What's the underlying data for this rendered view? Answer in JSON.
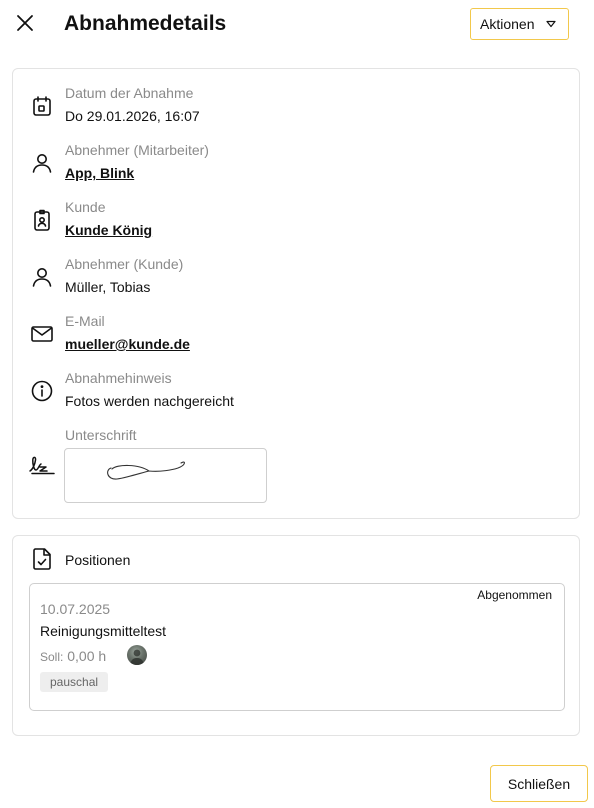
{
  "header": {
    "title": "Abnahmedetails",
    "actions_label": "Aktionen"
  },
  "details": [
    {
      "label": "Datum der Abnahme",
      "value": "Do 29.01.2026, 16:07",
      "icon": "calendar-icon",
      "link": false
    },
    {
      "label": "Abnehmer (Mitarbeiter)",
      "value": "App, Blink",
      "icon": "user-icon",
      "link": true
    },
    {
      "label": "Kunde",
      "value": "Kunde König",
      "icon": "badge-icon",
      "link": true
    },
    {
      "label": "Abnehmer (Kunde)",
      "value": "Müller, Tobias",
      "icon": "user-icon",
      "link": false
    },
    {
      "label": "E-Mail",
      "value": "mueller@kunde.de",
      "icon": "mail-icon",
      "link": true
    },
    {
      "label": "Abnahmehinweis",
      "value": "Fotos werden nachgereicht",
      "icon": "info-icon",
      "link": false
    }
  ],
  "signature": {
    "label": "Unterschrift",
    "icon": "signature-icon"
  },
  "positions": {
    "title": "Positionen",
    "icon": "document-check-icon",
    "items": [
      {
        "status": "Abgenommen",
        "date": "10.07.2025",
        "name": "Reinigungsmitteltest",
        "soll_label": "Soll:",
        "soll_value": "0,00 h",
        "tag": "pauschal"
      }
    ]
  },
  "footer": {
    "close_label": "Schließen"
  },
  "colors": {
    "accent_border": "#f2c84b",
    "muted_text": "#8a8a8a",
    "card_border": "#e3e3e3"
  }
}
